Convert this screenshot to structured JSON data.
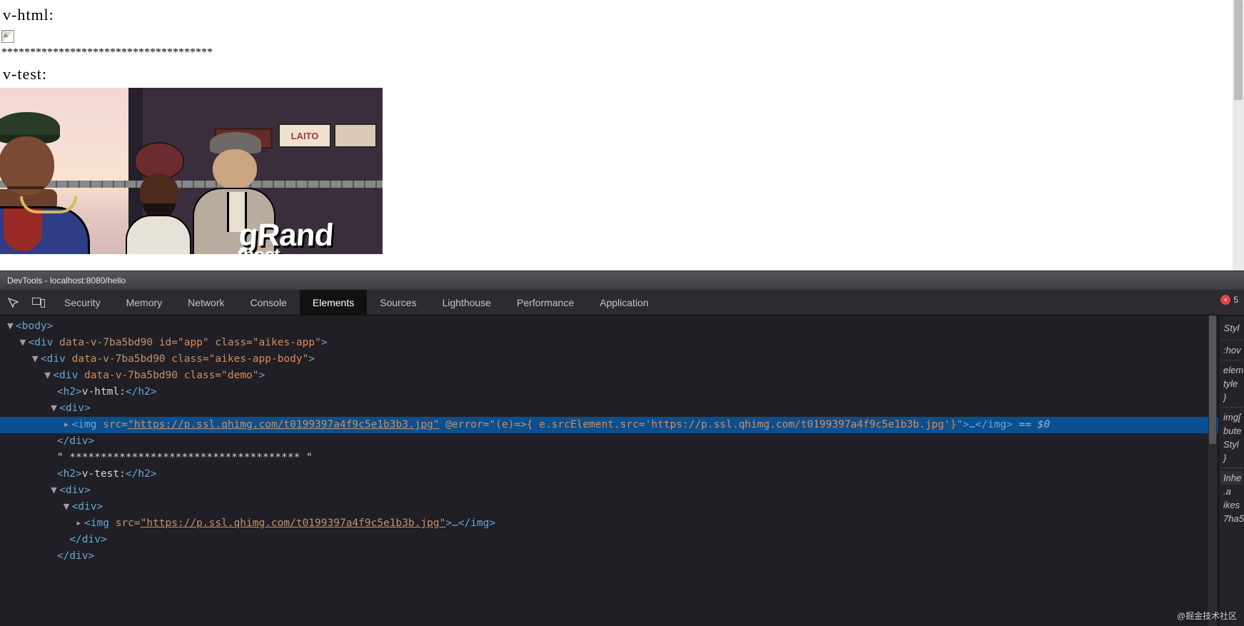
{
  "page": {
    "h1": "v-html:",
    "stars": "*************************************",
    "h2": "v-test:",
    "sign_text": "LAITO",
    "logo_top": "gRand",
    "logo_bot": "thoct"
  },
  "devtools": {
    "title": "DevTools - localhost:8080/hello",
    "tabs": [
      "Security",
      "Memory",
      "Network",
      "Console",
      "Elements",
      "Sources",
      "Lighthouse",
      "Performance",
      "Application"
    ],
    "active_tab": "Elements",
    "error_count": "5",
    "error_icon": "×"
  },
  "dom": {
    "body_open": "<body>",
    "app_open_pre": "<div ",
    "app_attr1_n": "data-v-7ba5bd90",
    "app_attr2_n": "id=",
    "app_attr2_v": "\"app\"",
    "app_attr3_n": "class=",
    "app_attr3_v": "\"aikes-app\"",
    "app_close": ">",
    "body_open2": "<div ",
    "body_attr1": "data-v-7ba5bd90",
    "body_attr2_n": "class=",
    "body_attr2_v": "\"aikes-app-body\"",
    "demo_open": "<div ",
    "demo_attr1": "data-v-7ba5bd90",
    "demo_attr2_n": "class=",
    "demo_attr2_v": "\"demo\"",
    "h2a_open": "<h2>",
    "h2a_text": "v-html:",
    "h2a_close": "</h2>",
    "div1_open": "<div>",
    "img1_open": "<img ",
    "img1_src_n": "src=",
    "img1_src_v": "\"https://p.ssl.qhimg.com/t0199397a4f9c5e1b3b3.jpg\"",
    "img1_err_n": " @error=",
    "img1_err_v": "\"(e)=>{ e.srcElement.src='https://p.ssl.qhimg.com/t0199397a4f9c5e1b3b.jpg'}\"",
    "img1_mid": ">…",
    "img1_close": "</img>",
    "eq0": " == $0",
    "div1_close": "</div>",
    "stars_text": "\" ************************************* \"",
    "h2b_open": "<h2>",
    "h2b_text": "v-test:",
    "h2b_close": "</h2>",
    "div2_open": "<div>",
    "div3_open": "<div>",
    "img2_open": "<img ",
    "img2_src_n": "src=",
    "img2_src_v": "\"https://p.ssl.qhimg.com/t0199397a4f9c5e1b3b.jpg\"",
    "img2_mid": ">…",
    "img2_close": "</img>",
    "div3_close": "</div>",
    "div2_close": "</div>"
  },
  "styles": {
    "tab": "Styl",
    "hov": ":hov",
    "l1": "elem",
    "l2": "tyle",
    "l3": "}",
    "l4": "img[",
    "l5": "bute",
    "l6": "Styl",
    "l7": "}",
    "inh": "Inhe",
    "l8": ".a",
    "l9": "ikes",
    "l10": "7ha5"
  },
  "watermark": "@掘金技术社区"
}
